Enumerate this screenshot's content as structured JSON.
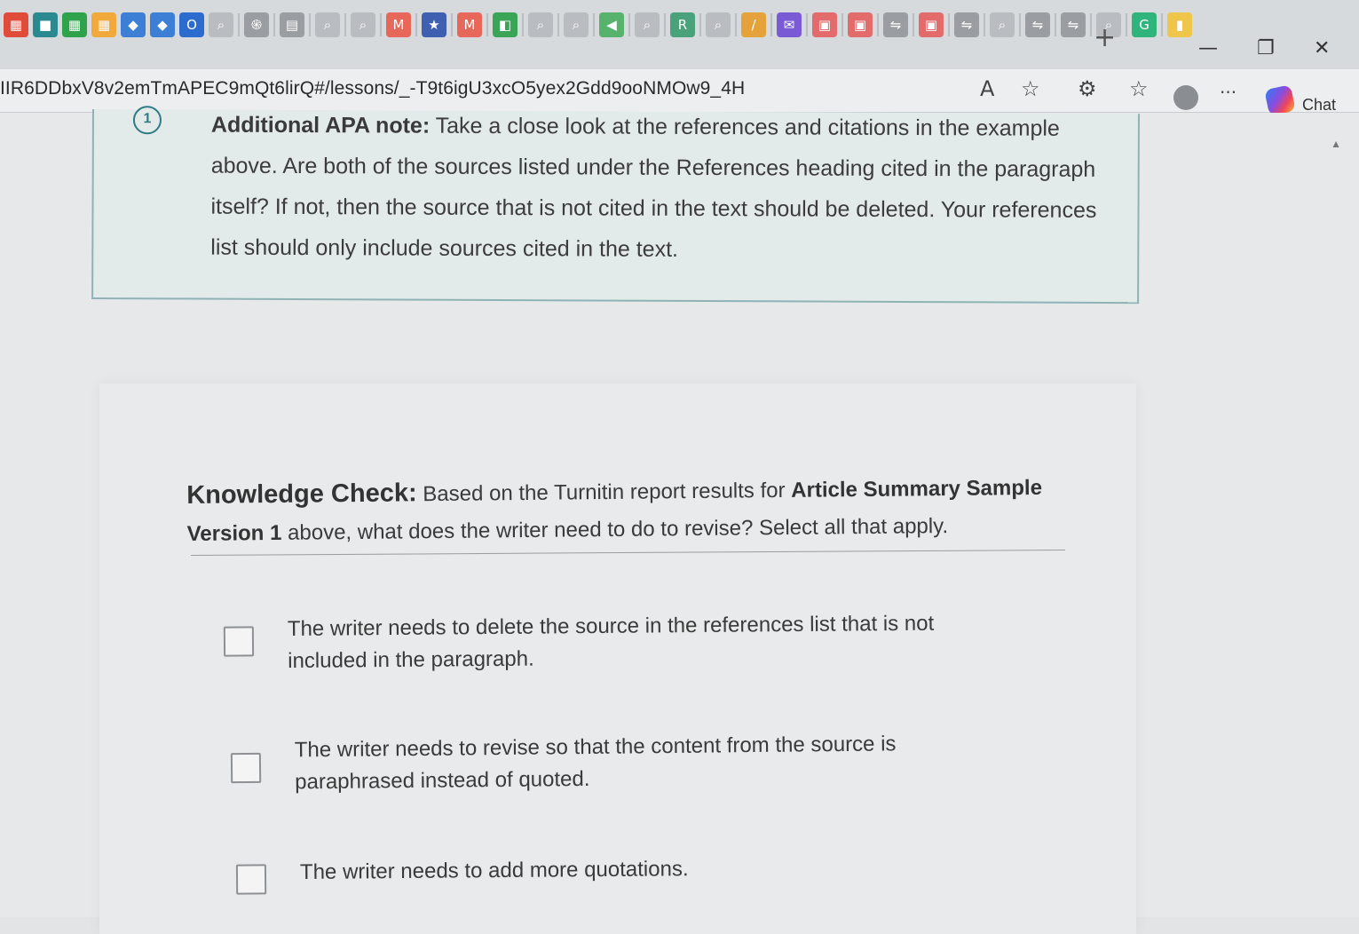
{
  "browser": {
    "tab_icons": [
      {
        "name": "microsoft-apps-icon",
        "color": "#e04b3a",
        "glyph": "▦"
      },
      {
        "name": "teal-app-icon",
        "color": "#2a8a8f",
        "glyph": "■"
      },
      {
        "name": "microsoft-apps-icon",
        "color": "#2fa34b",
        "glyph": "▦"
      },
      {
        "name": "microsoft-apps-icon",
        "color": "#f2a93b",
        "glyph": "▦"
      },
      {
        "name": "teams-icon",
        "color": "#3e7fd6",
        "glyph": "◆"
      },
      {
        "name": "teams-icon",
        "color": "#3e7fd6",
        "glyph": "◆"
      },
      {
        "name": "outlook-icon",
        "color": "#2d6ccf",
        "glyph": "O"
      },
      {
        "name": "search-tab-icon",
        "color": "#b9bcc0",
        "glyph": "⌕"
      },
      {
        "name": "chatgpt-icon",
        "color": "#9a9da1",
        "glyph": "֍"
      },
      {
        "name": "calendar-icon",
        "color": "#9a9da1",
        "glyph": "▤"
      },
      {
        "name": "search-tab-icon",
        "color": "#b9bcc0",
        "glyph": "⌕"
      },
      {
        "name": "search-tab-icon",
        "color": "#b9bcc0",
        "glyph": "⌕"
      },
      {
        "name": "gmail-icon",
        "color": "#e7685a",
        "glyph": "M"
      },
      {
        "name": "star-app-icon",
        "color": "#3f5fb0",
        "glyph": "★"
      },
      {
        "name": "gmail-icon",
        "color": "#e7685a",
        "glyph": "M"
      },
      {
        "name": "green-app-icon",
        "color": "#3aa457",
        "glyph": "◧"
      },
      {
        "name": "search-tab-icon",
        "color": "#b9bcc0",
        "glyph": "⌕"
      },
      {
        "name": "search-tab-icon",
        "color": "#b9bcc0",
        "glyph": "⌕"
      },
      {
        "name": "green-arrow-icon",
        "color": "#57b36b",
        "glyph": "◀"
      },
      {
        "name": "search-tab-icon",
        "color": "#b9bcc0",
        "glyph": "⌕"
      },
      {
        "name": "r-app-icon",
        "color": "#4aa27a",
        "glyph": "R"
      },
      {
        "name": "search-tab-icon",
        "color": "#b9bcc0",
        "glyph": "⌕"
      },
      {
        "name": "slash-app-icon",
        "color": "#e6a23a",
        "glyph": "/"
      },
      {
        "name": "mail-icon",
        "color": "#7b5ad6",
        "glyph": "✉"
      },
      {
        "name": "pdf-icon",
        "color": "#e46b6b",
        "glyph": "▣"
      },
      {
        "name": "pdf-icon",
        "color": "#e46b6b",
        "glyph": "▣"
      },
      {
        "name": "folder-sync-icon",
        "color": "#9a9da1",
        "glyph": "⇋"
      },
      {
        "name": "pdf-icon",
        "color": "#e46b6b",
        "glyph": "▣"
      },
      {
        "name": "folder-sync-icon",
        "color": "#9a9da1",
        "glyph": "⇋"
      },
      {
        "name": "search-tab-icon",
        "color": "#b9bcc0",
        "glyph": "⌕"
      },
      {
        "name": "folder-sync-icon",
        "color": "#9a9da1",
        "glyph": "⇋"
      },
      {
        "name": "folder-sync-icon",
        "color": "#9a9da1",
        "glyph": "⇋"
      },
      {
        "name": "search-tab-icon",
        "color": "#b9bcc0",
        "glyph": "⌕"
      },
      {
        "name": "grammarly-icon",
        "color": "#2fb57c",
        "glyph": "G"
      },
      {
        "name": "yellow-app-icon",
        "color": "#f0c64a",
        "glyph": "▮"
      }
    ],
    "new_tab_glyph": "+",
    "minimize_glyph": "—",
    "restore_glyph": "❐",
    "close_glyph": "✕",
    "url": "IIR6DDbxV8v2emTmAPEC9mQt6lirQ#/lessons/_-T9t6igU3xcO5yex2Gdd9ooNMOw9_4H",
    "read_aloud_glyph": "A",
    "favorite_glyph": "☆",
    "extensions_glyph": "⚙",
    "favorites_bar_glyph": "☆",
    "more_glyph": "···",
    "chat_label": "Chat"
  },
  "note": {
    "icon_text": "1",
    "heading": "Additional APA note:",
    "body_line1": "Take a close look at the references and citations in the example",
    "body_rest": "above. Are both of the sources listed under the References heading cited in the paragraph itself? If not, then the source that is not cited in the text should be deleted. Your references list should only include sources cited in the text."
  },
  "knowledge_check": {
    "title": "Knowledge Check:",
    "prompt_pre": "Based on the Turnitin report results for",
    "prompt_bold": "Article Summary Sample Version 1",
    "prompt_post": "above, what does the writer need to do to revise? Select all that apply.",
    "options": [
      {
        "label": "The writer needs to delete the source in the references list that is not included in the paragraph.",
        "checked": false
      },
      {
        "label": "The writer needs to revise so that the content from the source is paraphrased instead of quoted.",
        "checked": false
      },
      {
        "label": "The writer needs to add more quotations.",
        "checked": false
      }
    ]
  }
}
